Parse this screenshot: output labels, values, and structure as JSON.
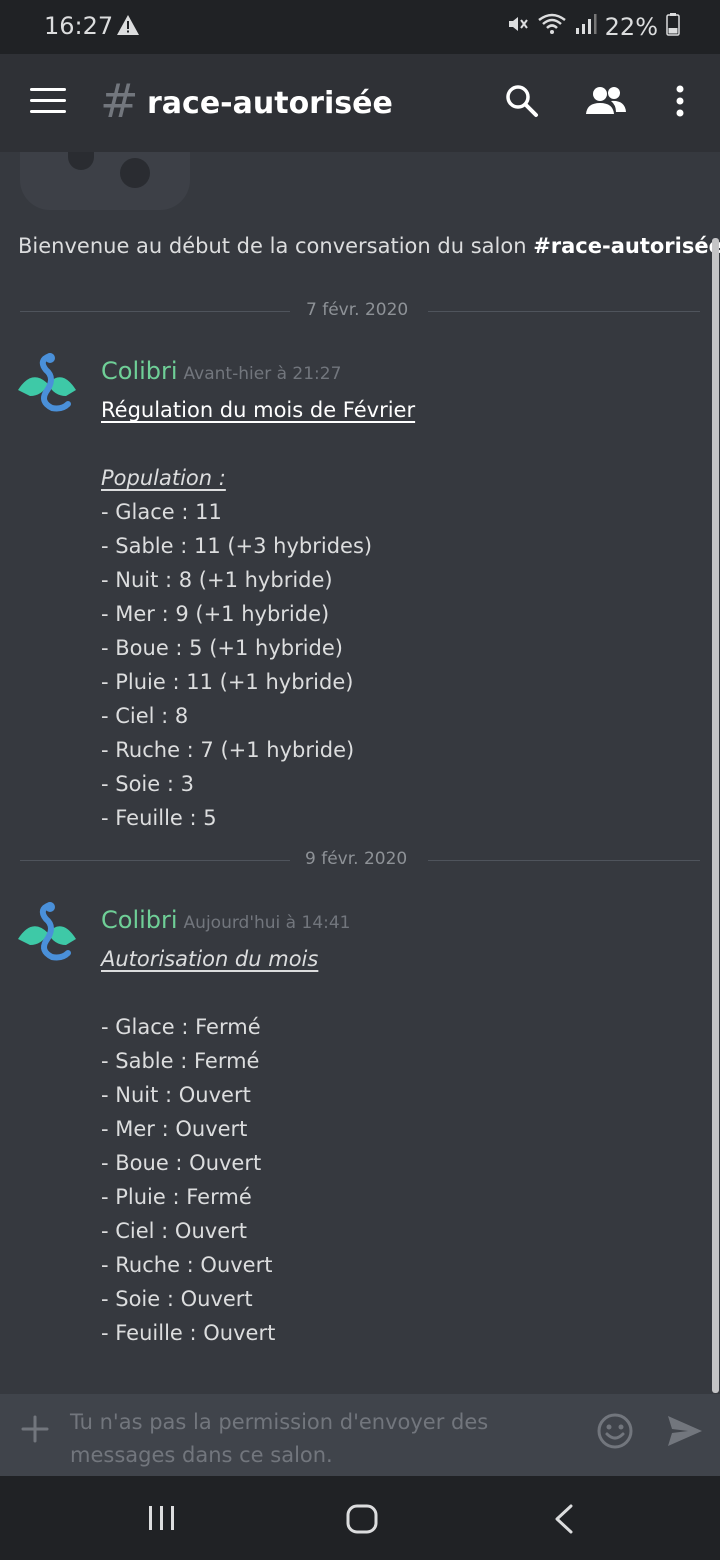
{
  "status_bar": {
    "time": "16:27",
    "battery": "22%"
  },
  "header": {
    "channel_name": "race-autorisée"
  },
  "welcome": {
    "text_prefix": "Bienvenue au début de la conversation du salon ",
    "channel": "#race-autorisée",
    "text_suffix": "."
  },
  "messages": [
    {
      "date_divider": "7 févr. 2020",
      "author": "Colibri",
      "timestamp": "Avant-hier à 21:27",
      "title": "Régulation du mois de Février",
      "subtitle": "Population :",
      "lines": [
        "- Glace : 11",
        "- Sable : 11 (+3 hybrides)",
        "- Nuit : 8 (+1 hybride)",
        "- Mer : 9 (+1 hybride)",
        "- Boue : 5 (+1 hybride)",
        "- Pluie : 11 (+1 hybride)",
        "- Ciel : 8",
        "- Ruche : 7 (+1 hybride)",
        "- Soie : 3",
        "- Feuille : 5"
      ]
    },
    {
      "date_divider": "9 févr. 2020",
      "author": "Colibri",
      "timestamp": "Aujourd'hui à 14:41",
      "title": "Autorisation du mois",
      "lines": [
        "- Glace : Fermé",
        "- Sable : Fermé",
        "- Nuit : Ouvert",
        "- Mer : Ouvert",
        "- Boue : Ouvert",
        "- Pluie : Fermé",
        "- Ciel : Ouvert",
        "- Ruche : Ouvert",
        "- Soie : Ouvert",
        "- Feuille : Ouvert"
      ]
    }
  ],
  "input": {
    "placeholder": "Tu n'as pas la permission d'envoyer des messages dans ce salon."
  },
  "colors": {
    "background": "#36393f",
    "header": "#2f3136",
    "author": "#6fcf97",
    "input": "#40444b"
  },
  "icons": [
    "warning-icon",
    "mute-icon",
    "wifi-icon",
    "signal-icon",
    "battery-icon",
    "menu-icon",
    "hash-icon",
    "search-icon",
    "members-icon",
    "more-icon",
    "plus-icon",
    "emoji-icon",
    "send-icon",
    "recents-icon",
    "home-icon",
    "back-icon"
  ]
}
